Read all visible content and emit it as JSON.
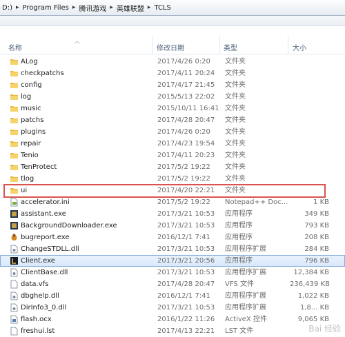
{
  "address": {
    "crumbs": [
      "D:)",
      "Program Files",
      "腾讯游戏",
      "英雄联盟",
      "TCLS"
    ],
    "separator": "▸"
  },
  "header": {
    "name": "名称",
    "date": "修改日期",
    "type": "类型",
    "size": "大小"
  },
  "rows": [
    {
      "icon": "folder-icon",
      "name": "ALog",
      "date": "2017/4/26 0:20",
      "type": "文件夹",
      "size": ""
    },
    {
      "icon": "folder-icon",
      "name": "checkpatchs",
      "date": "2017/4/11 20:24",
      "type": "文件夹",
      "size": ""
    },
    {
      "icon": "folder-icon",
      "name": "config",
      "date": "2017/4/17 21:45",
      "type": "文件夹",
      "size": ""
    },
    {
      "icon": "folder-icon",
      "name": "log",
      "date": "2015/5/13 22:02",
      "type": "文件夹",
      "size": ""
    },
    {
      "icon": "folder-icon",
      "name": "music",
      "date": "2015/10/11 16:41",
      "type": "文件夹",
      "size": ""
    },
    {
      "icon": "folder-icon",
      "name": "patchs",
      "date": "2017/4/28 20:47",
      "type": "文件夹",
      "size": ""
    },
    {
      "icon": "folder-icon",
      "name": "plugins",
      "date": "2017/4/26 0:20",
      "type": "文件夹",
      "size": ""
    },
    {
      "icon": "folder-icon",
      "name": "repair",
      "date": "2017/4/23 19:54",
      "type": "文件夹",
      "size": ""
    },
    {
      "icon": "folder-icon",
      "name": "Tenio",
      "date": "2017/4/11 20:23",
      "type": "文件夹",
      "size": ""
    },
    {
      "icon": "folder-icon",
      "name": "TenProtect",
      "date": "2017/5/2 19:22",
      "type": "文件夹",
      "size": ""
    },
    {
      "icon": "folder-icon",
      "name": "tlog",
      "date": "2017/5/2 19:22",
      "type": "文件夹",
      "size": ""
    },
    {
      "icon": "folder-icon",
      "name": "ui",
      "date": "2017/4/20 22:21",
      "type": "文件夹",
      "size": ""
    },
    {
      "icon": "ini-file-icon",
      "name": "accelerator.ini",
      "date": "2017/5/2 19:22",
      "type": "Notepad++ Doc...",
      "size": "1 KB"
    },
    {
      "icon": "exe-icon",
      "name": "assistant.exe",
      "date": "2017/3/21 10:53",
      "type": "应用程序",
      "size": "349 KB"
    },
    {
      "icon": "exe-icon",
      "name": "BackgroundDownloader.exe",
      "date": "2017/3/21 10:53",
      "type": "应用程序",
      "size": "793 KB"
    },
    {
      "icon": "bug-exe-icon",
      "name": "bugreport.exe",
      "date": "2016/12/1 7:41",
      "type": "应用程序",
      "size": "208 KB"
    },
    {
      "icon": "dll-icon",
      "name": "ChangeSTDLL.dll",
      "date": "2017/3/21 10:53",
      "type": "应用程序扩展",
      "size": "284 KB"
    },
    {
      "icon": "lol-exe-icon",
      "name": "Client.exe",
      "date": "2017/3/21 20:56",
      "type": "应用程序",
      "size": "796 KB"
    },
    {
      "icon": "dll-icon",
      "name": "ClientBase.dll",
      "date": "2017/3/21 10:53",
      "type": "应用程序扩展",
      "size": "12,384 KB"
    },
    {
      "icon": "file-icon",
      "name": "data.vfs",
      "date": "2017/4/28 20:47",
      "type": "VFS 文件",
      "size": "236,439 KB"
    },
    {
      "icon": "dll-icon",
      "name": "dbghelp.dll",
      "date": "2016/12/1 7:41",
      "type": "应用程序扩展",
      "size": "1,022 KB"
    },
    {
      "icon": "dll-icon",
      "name": "DirInfo3_0.dll",
      "date": "2017/3/21 10:53",
      "type": "应用程序扩展",
      "size": "1,8... KB"
    },
    {
      "icon": "ocx-icon",
      "name": "flash.ocx",
      "date": "2016/1/22 11:26",
      "type": "ActiveX 控件",
      "size": "9,065 KB"
    },
    {
      "icon": "file-icon",
      "name": "freshui.lst",
      "date": "2017/4/13 22:21",
      "type": "LST 文件",
      "size": ""
    }
  ],
  "selected_row": 17,
  "highlighted_row": 11,
  "watermark": "Bai 经验",
  "colors": {
    "highlight_box": "#d9534f",
    "selection_border": "#84acdd",
    "folder": "#f1c453"
  }
}
